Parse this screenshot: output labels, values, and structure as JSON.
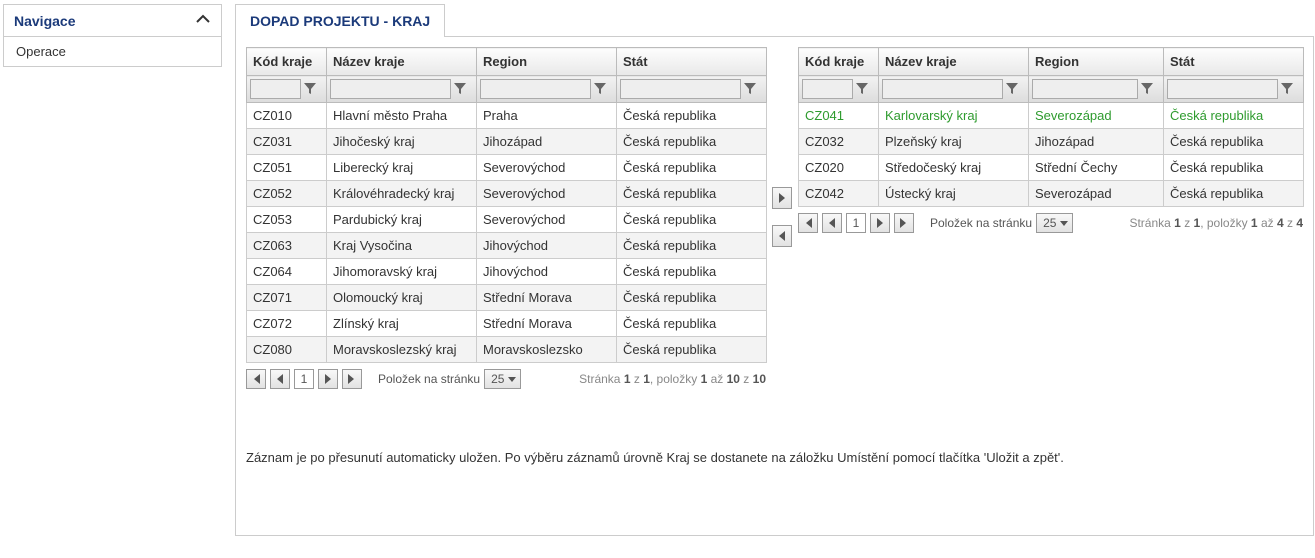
{
  "sidebar": {
    "title": "Navigace",
    "items": [
      {
        "label": "Operace"
      }
    ]
  },
  "tab": {
    "title": "DOPAD PROJEKTU - KRAJ"
  },
  "grid_headers": {
    "code": "Kód kraje",
    "name": "Název kraje",
    "region": "Region",
    "state": "Stát"
  },
  "left_grid": {
    "rows": [
      {
        "code": "CZ010",
        "name": "Hlavní město Praha",
        "region": "Praha",
        "state": "Česká republika"
      },
      {
        "code": "CZ031",
        "name": "Jihočeský kraj",
        "region": "Jihozápad",
        "state": "Česká republika"
      },
      {
        "code": "CZ051",
        "name": "Liberecký kraj",
        "region": "Severovýchod",
        "state": "Česká republika"
      },
      {
        "code": "CZ052",
        "name": "Královéhradecký kraj",
        "region": "Severovýchod",
        "state": "Česká republika"
      },
      {
        "code": "CZ053",
        "name": "Pardubický kraj",
        "region": "Severovýchod",
        "state": "Česká republika"
      },
      {
        "code": "CZ063",
        "name": "Kraj Vysočina",
        "region": "Jihovýchod",
        "state": "Česká republika"
      },
      {
        "code": "CZ064",
        "name": "Jihomoravský kraj",
        "region": "Jihovýchod",
        "state": "Česká republika"
      },
      {
        "code": "CZ071",
        "name": "Olomoucký kraj",
        "region": "Střední Morava",
        "state": "Česká republika"
      },
      {
        "code": "CZ072",
        "name": "Zlínský kraj",
        "region": "Střední Morava",
        "state": "Česká republika"
      },
      {
        "code": "CZ080",
        "name": "Moravskoslezský kraj",
        "region": "Moravskoslezsko",
        "state": "Česká republika"
      }
    ],
    "pager": {
      "page": "1",
      "per_page_label": "Položek na stránku",
      "per_page_value": "25",
      "info_prefix": "Stránka ",
      "info_page_cur": "1",
      "info_page_sep": " z ",
      "info_page_total": "1",
      "info_items_sep": ", položky ",
      "info_items_from": "1",
      "info_items_to_sep": " až ",
      "info_items_to": "10",
      "info_items_of_sep": " z ",
      "info_items_total": "10"
    }
  },
  "right_grid": {
    "rows": [
      {
        "code": "CZ041",
        "name": "Karlovarský kraj",
        "region": "Severozápad",
        "state": "Česká republika",
        "highlight": true
      },
      {
        "code": "CZ032",
        "name": "Plzeňský kraj",
        "region": "Jihozápad",
        "state": "Česká republika",
        "highlight": false
      },
      {
        "code": "CZ020",
        "name": "Středočeský kraj",
        "region": "Střední Čechy",
        "state": "Česká republika",
        "highlight": false
      },
      {
        "code": "CZ042",
        "name": "Ústecký kraj",
        "region": "Severozápad",
        "state": "Česká republika",
        "highlight": false
      }
    ],
    "pager": {
      "page": "1",
      "per_page_label": "Položek na stránku",
      "per_page_value": "25",
      "info_prefix": "Stránka ",
      "info_page_cur": "1",
      "info_page_sep": " z ",
      "info_page_total": "1",
      "info_items_sep": ", položky ",
      "info_items_from": "1",
      "info_items_to_sep": " až ",
      "info_items_to": "4",
      "info_items_of_sep": " z ",
      "info_items_total": "4"
    }
  },
  "footer_note": "Záznam je po přesunutí automaticky uložen. Po výběru záznamů úrovně Kraj se dostanete na záložku Umístění pomocí tlačítka 'Uložit a zpět'."
}
